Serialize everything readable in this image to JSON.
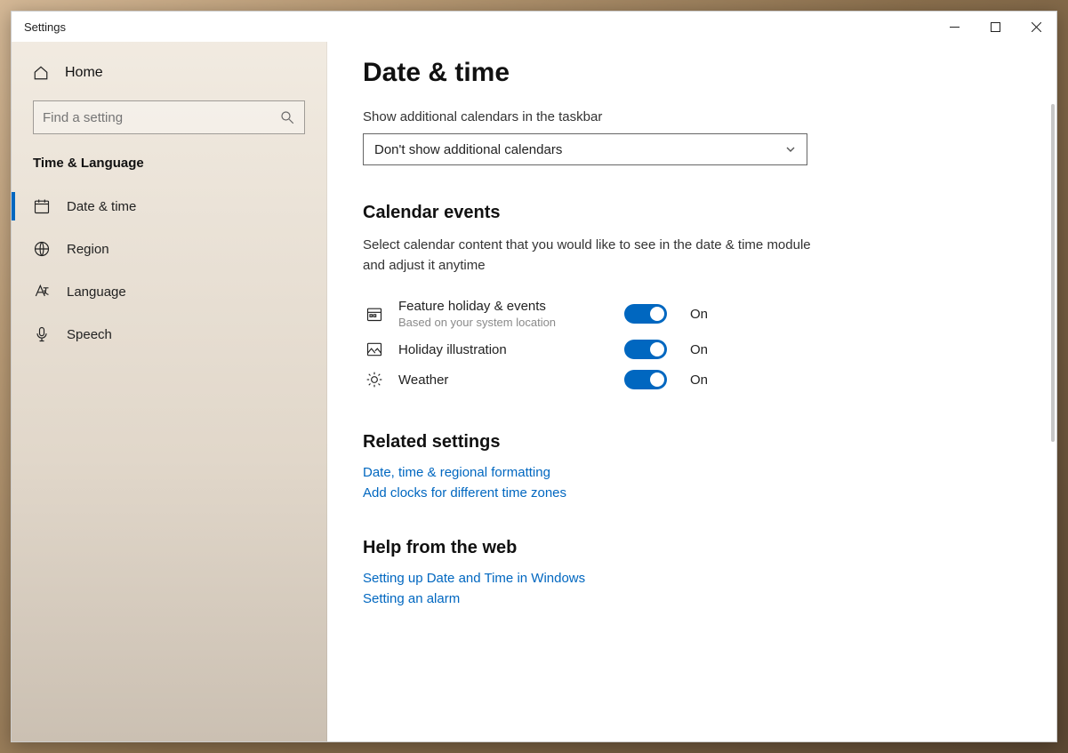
{
  "window": {
    "title": "Settings"
  },
  "sidebar": {
    "home_label": "Home",
    "search_placeholder": "Find a setting",
    "section_label": "Time & Language",
    "items": [
      {
        "label": "Date & time",
        "icon": "date-time-icon",
        "active": true
      },
      {
        "label": "Region",
        "icon": "region-icon",
        "active": false
      },
      {
        "label": "Language",
        "icon": "language-icon",
        "active": false
      },
      {
        "label": "Speech",
        "icon": "speech-icon",
        "active": false
      }
    ]
  },
  "main": {
    "page_title": "Date & time",
    "additional_calendars": {
      "label": "Show additional calendars in the taskbar",
      "value": "Don't show additional calendars"
    },
    "calendar_events": {
      "heading": "Calendar events",
      "description": "Select calendar content that you would like to see in the date & time module and adjust it anytime",
      "items": [
        {
          "title": "Feature holiday & events",
          "subtitle": "Based on your system location",
          "state_label": "On"
        },
        {
          "title": "Holiday illustration",
          "subtitle": "",
          "state_label": "On"
        },
        {
          "title": "Weather",
          "subtitle": "",
          "state_label": "On"
        }
      ]
    },
    "related": {
      "heading": "Related settings",
      "links": [
        "Date, time & regional formatting",
        "Add clocks for different time zones"
      ]
    },
    "help": {
      "heading": "Help from the web",
      "links": [
        "Setting up Date and Time in Windows",
        "Setting an alarm"
      ]
    }
  }
}
